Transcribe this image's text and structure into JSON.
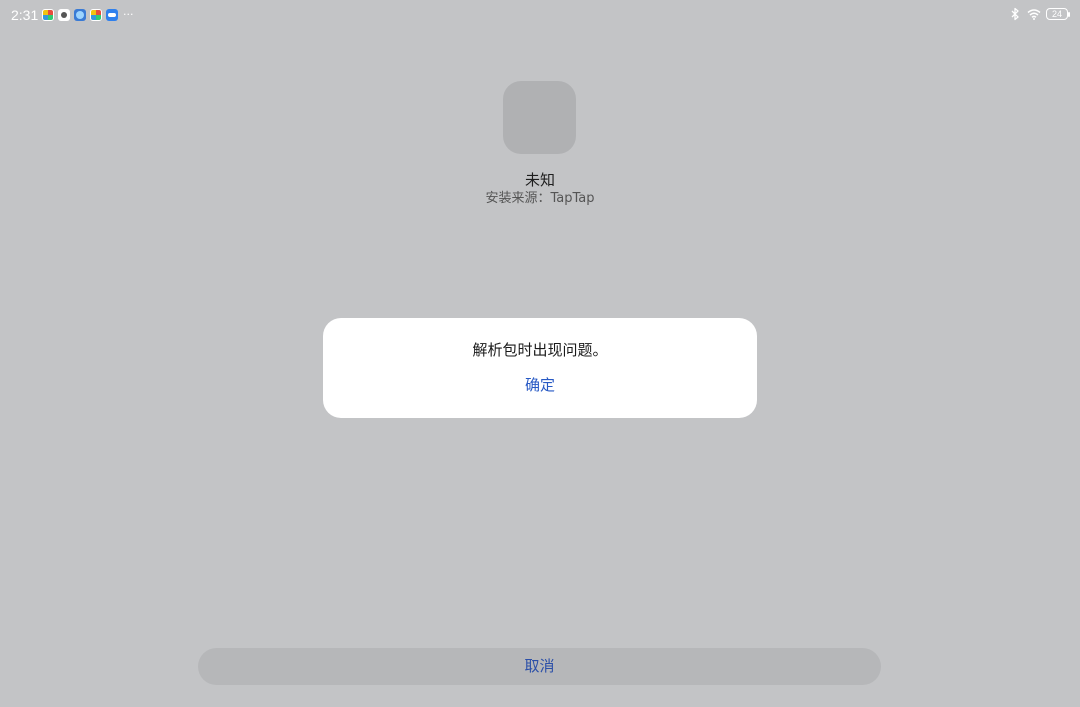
{
  "status_bar": {
    "time": "2:31",
    "notification_icons": [
      "pinwheel-icon",
      "camera-icon",
      "browser-icon",
      "pinwheel-icon",
      "cloud-icon"
    ],
    "more": "···",
    "battery_level": "24"
  },
  "app": {
    "name": "未知",
    "source": "安装来源：TapTap"
  },
  "dialog": {
    "message": "解析包时出现问题。",
    "confirm_label": "确定"
  },
  "footer": {
    "cancel_label": "取消"
  },
  "colors": {
    "background": "#c3c4c6",
    "accent": "#2759c4",
    "dialog_bg": "#ffffff"
  }
}
